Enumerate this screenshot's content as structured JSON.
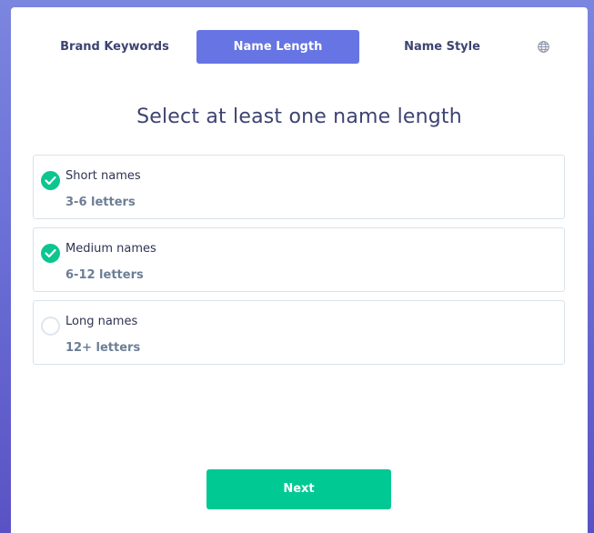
{
  "tabs": [
    {
      "label": "Brand Keywords",
      "active": false
    },
    {
      "label": "Name Length",
      "active": true
    },
    {
      "label": "Name Style",
      "active": false
    }
  ],
  "language_icon": "globe-icon",
  "title": "Select at least one name length",
  "options": [
    {
      "label": "Short names",
      "description": "3-6 letters",
      "checked": true
    },
    {
      "label": "Medium names",
      "description": "6-12 letters",
      "checked": true
    },
    {
      "label": "Long names",
      "description": "12+ letters",
      "checked": false
    }
  ],
  "next_button": {
    "label": "Next"
  },
  "colors": {
    "accent": "#6674e4",
    "success": "#00c994",
    "text": "#3d4372",
    "muted": "#6b7e95",
    "background_top": "#7b86df",
    "background_bottom": "#5a52c4"
  }
}
